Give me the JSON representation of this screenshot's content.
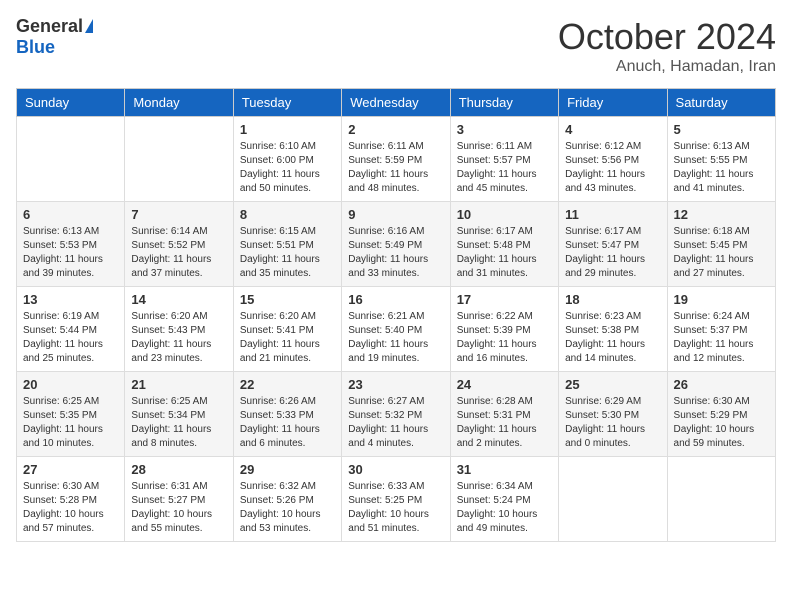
{
  "logo": {
    "general": "General",
    "blue": "Blue"
  },
  "title": "October 2024",
  "subtitle": "Anuch, Hamadan, Iran",
  "headers": [
    "Sunday",
    "Monday",
    "Tuesday",
    "Wednesday",
    "Thursday",
    "Friday",
    "Saturday"
  ],
  "weeks": [
    [
      {
        "day": "",
        "sunrise": "",
        "sunset": "",
        "daylight": ""
      },
      {
        "day": "",
        "sunrise": "",
        "sunset": "",
        "daylight": ""
      },
      {
        "day": "1",
        "sunrise": "Sunrise: 6:10 AM",
        "sunset": "Sunset: 6:00 PM",
        "daylight": "Daylight: 11 hours and 50 minutes."
      },
      {
        "day": "2",
        "sunrise": "Sunrise: 6:11 AM",
        "sunset": "Sunset: 5:59 PM",
        "daylight": "Daylight: 11 hours and 48 minutes."
      },
      {
        "day": "3",
        "sunrise": "Sunrise: 6:11 AM",
        "sunset": "Sunset: 5:57 PM",
        "daylight": "Daylight: 11 hours and 45 minutes."
      },
      {
        "day": "4",
        "sunrise": "Sunrise: 6:12 AM",
        "sunset": "Sunset: 5:56 PM",
        "daylight": "Daylight: 11 hours and 43 minutes."
      },
      {
        "day": "5",
        "sunrise": "Sunrise: 6:13 AM",
        "sunset": "Sunset: 5:55 PM",
        "daylight": "Daylight: 11 hours and 41 minutes."
      }
    ],
    [
      {
        "day": "6",
        "sunrise": "Sunrise: 6:13 AM",
        "sunset": "Sunset: 5:53 PM",
        "daylight": "Daylight: 11 hours and 39 minutes."
      },
      {
        "day": "7",
        "sunrise": "Sunrise: 6:14 AM",
        "sunset": "Sunset: 5:52 PM",
        "daylight": "Daylight: 11 hours and 37 minutes."
      },
      {
        "day": "8",
        "sunrise": "Sunrise: 6:15 AM",
        "sunset": "Sunset: 5:51 PM",
        "daylight": "Daylight: 11 hours and 35 minutes."
      },
      {
        "day": "9",
        "sunrise": "Sunrise: 6:16 AM",
        "sunset": "Sunset: 5:49 PM",
        "daylight": "Daylight: 11 hours and 33 minutes."
      },
      {
        "day": "10",
        "sunrise": "Sunrise: 6:17 AM",
        "sunset": "Sunset: 5:48 PM",
        "daylight": "Daylight: 11 hours and 31 minutes."
      },
      {
        "day": "11",
        "sunrise": "Sunrise: 6:17 AM",
        "sunset": "Sunset: 5:47 PM",
        "daylight": "Daylight: 11 hours and 29 minutes."
      },
      {
        "day": "12",
        "sunrise": "Sunrise: 6:18 AM",
        "sunset": "Sunset: 5:45 PM",
        "daylight": "Daylight: 11 hours and 27 minutes."
      }
    ],
    [
      {
        "day": "13",
        "sunrise": "Sunrise: 6:19 AM",
        "sunset": "Sunset: 5:44 PM",
        "daylight": "Daylight: 11 hours and 25 minutes."
      },
      {
        "day": "14",
        "sunrise": "Sunrise: 6:20 AM",
        "sunset": "Sunset: 5:43 PM",
        "daylight": "Daylight: 11 hours and 23 minutes."
      },
      {
        "day": "15",
        "sunrise": "Sunrise: 6:20 AM",
        "sunset": "Sunset: 5:41 PM",
        "daylight": "Daylight: 11 hours and 21 minutes."
      },
      {
        "day": "16",
        "sunrise": "Sunrise: 6:21 AM",
        "sunset": "Sunset: 5:40 PM",
        "daylight": "Daylight: 11 hours and 19 minutes."
      },
      {
        "day": "17",
        "sunrise": "Sunrise: 6:22 AM",
        "sunset": "Sunset: 5:39 PM",
        "daylight": "Daylight: 11 hours and 16 minutes."
      },
      {
        "day": "18",
        "sunrise": "Sunrise: 6:23 AM",
        "sunset": "Sunset: 5:38 PM",
        "daylight": "Daylight: 11 hours and 14 minutes."
      },
      {
        "day": "19",
        "sunrise": "Sunrise: 6:24 AM",
        "sunset": "Sunset: 5:37 PM",
        "daylight": "Daylight: 11 hours and 12 minutes."
      }
    ],
    [
      {
        "day": "20",
        "sunrise": "Sunrise: 6:25 AM",
        "sunset": "Sunset: 5:35 PM",
        "daylight": "Daylight: 11 hours and 10 minutes."
      },
      {
        "day": "21",
        "sunrise": "Sunrise: 6:25 AM",
        "sunset": "Sunset: 5:34 PM",
        "daylight": "Daylight: 11 hours and 8 minutes."
      },
      {
        "day": "22",
        "sunrise": "Sunrise: 6:26 AM",
        "sunset": "Sunset: 5:33 PM",
        "daylight": "Daylight: 11 hours and 6 minutes."
      },
      {
        "day": "23",
        "sunrise": "Sunrise: 6:27 AM",
        "sunset": "Sunset: 5:32 PM",
        "daylight": "Daylight: 11 hours and 4 minutes."
      },
      {
        "day": "24",
        "sunrise": "Sunrise: 6:28 AM",
        "sunset": "Sunset: 5:31 PM",
        "daylight": "Daylight: 11 hours and 2 minutes."
      },
      {
        "day": "25",
        "sunrise": "Sunrise: 6:29 AM",
        "sunset": "Sunset: 5:30 PM",
        "daylight": "Daylight: 11 hours and 0 minutes."
      },
      {
        "day": "26",
        "sunrise": "Sunrise: 6:30 AM",
        "sunset": "Sunset: 5:29 PM",
        "daylight": "Daylight: 10 hours and 59 minutes."
      }
    ],
    [
      {
        "day": "27",
        "sunrise": "Sunrise: 6:30 AM",
        "sunset": "Sunset: 5:28 PM",
        "daylight": "Daylight: 10 hours and 57 minutes."
      },
      {
        "day": "28",
        "sunrise": "Sunrise: 6:31 AM",
        "sunset": "Sunset: 5:27 PM",
        "daylight": "Daylight: 10 hours and 55 minutes."
      },
      {
        "day": "29",
        "sunrise": "Sunrise: 6:32 AM",
        "sunset": "Sunset: 5:26 PM",
        "daylight": "Daylight: 10 hours and 53 minutes."
      },
      {
        "day": "30",
        "sunrise": "Sunrise: 6:33 AM",
        "sunset": "Sunset: 5:25 PM",
        "daylight": "Daylight: 10 hours and 51 minutes."
      },
      {
        "day": "31",
        "sunrise": "Sunrise: 6:34 AM",
        "sunset": "Sunset: 5:24 PM",
        "daylight": "Daylight: 10 hours and 49 minutes."
      },
      {
        "day": "",
        "sunrise": "",
        "sunset": "",
        "daylight": ""
      },
      {
        "day": "",
        "sunrise": "",
        "sunset": "",
        "daylight": ""
      }
    ]
  ]
}
